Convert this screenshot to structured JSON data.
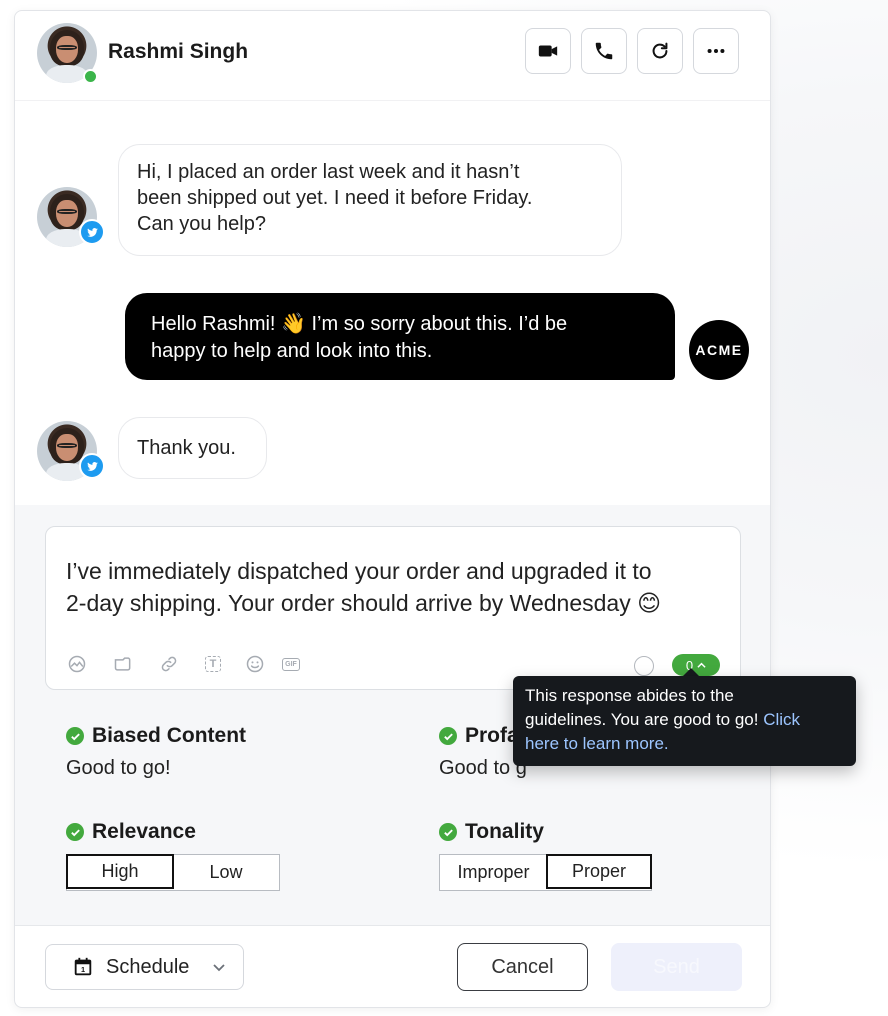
{
  "header": {
    "contact_name": "Rashmi Singh",
    "actions": [
      "video-icon",
      "phone-icon",
      "refresh-icon",
      "more-icon"
    ]
  },
  "messages": [
    {
      "from": "customer",
      "channel": "twitter",
      "text_lines": [
        "Hi, I placed an order last week and it hasn’t",
        "been shipped out yet. I need it before Friday.",
        "Can you help?"
      ]
    },
    {
      "from": "agent",
      "text_lines": [
        "Hello Rashmi! 👋 I’m so sorry about this. I’d be",
        "happy to help and look into this."
      ],
      "logo": "ACME"
    },
    {
      "from": "customer",
      "channel": "twitter",
      "text_lines": [
        "Thank you."
      ]
    }
  ],
  "composer": {
    "text_lines": [
      "I’ve immediately dispatched your order and upgraded it to",
      "2-day shipping. Your order should arrive by Wednesday 😊"
    ],
    "tools": [
      "camera-icon",
      "video-camera-icon",
      "link-icon",
      "text-icon",
      "emoji-icon",
      "gif-icon"
    ],
    "gif_label": "GIF",
    "text_tool_label": "T",
    "score": "0"
  },
  "tooltip": {
    "line1": "This response abides to the",
    "line2_prefix": "guidelines. You are good to go!",
    "line2_link": "Click",
    "line3_link": "here to learn more."
  },
  "checks": {
    "biased": {
      "title": "Biased Content",
      "value": "Good to go!"
    },
    "profanity": {
      "title": "Profa",
      "value": "Good to g"
    },
    "relevance": {
      "title": "Relevance",
      "options": [
        "High",
        "Low"
      ],
      "selected": "High"
    },
    "tonality": {
      "title": "Tonality",
      "options": [
        "Improper",
        "Proper"
      ],
      "selected": "Proper"
    }
  },
  "footer": {
    "schedule_label": "Schedule",
    "cancel_label": "Cancel",
    "send_label": "Send"
  },
  "colors": {
    "accent_green": "#43a93e",
    "twitter_blue": "#1d9bf0",
    "agent_bubble": "#000000",
    "send_disabled": "#eef0fb"
  }
}
